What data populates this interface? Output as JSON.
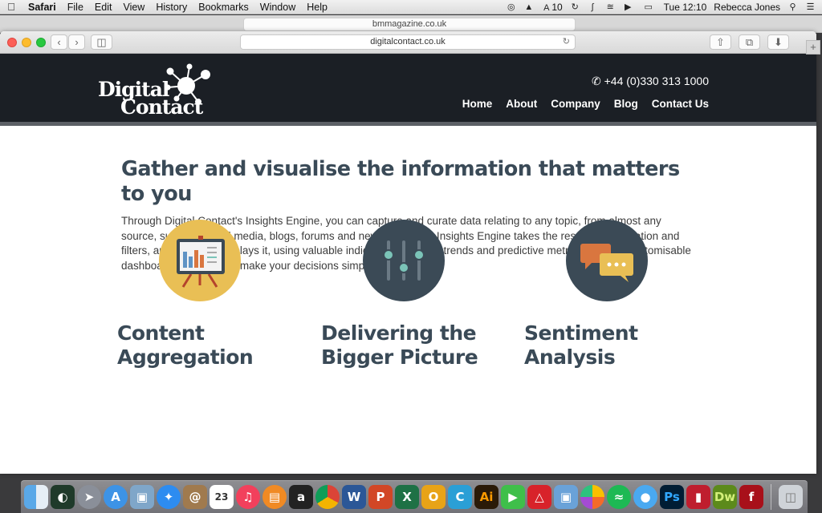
{
  "menubar": {
    "app": "Safari",
    "items": [
      "File",
      "Edit",
      "View",
      "History",
      "Bookmarks",
      "Window",
      "Help"
    ],
    "status_count": "10",
    "clock": "Tue 12:10",
    "user": "Rebecca Jones"
  },
  "back_window": {
    "url": "bmmagazine.co.uk"
  },
  "browser": {
    "url": "digitalcontact.co.uk"
  },
  "site": {
    "logo_line1": "Digital",
    "logo_line2": "Contact",
    "phone": "+44 (0)330 313 1000",
    "nav": [
      "Home",
      "About",
      "Company",
      "Blog",
      "Contact Us"
    ]
  },
  "main": {
    "headline": "Gather and visualise the information that matters to you",
    "intro": "Through Digital Contact's Insights Engine, you can capture and curate data relating to any topic, from almost any source, such as: social media, blogs, forums and news sites. The Insights Engine takes the resulting information and filters, analyses and displays it, using valuable indicators, patterns, trends and predictive metrics, through customisable dashboards – helping to make your decisions simple with big data.",
    "features": [
      {
        "title_line1": "Content",
        "title_line2": "Aggregation",
        "icon": "presentation-board-icon",
        "color": "#e9bf55"
      },
      {
        "title_line1": "Delivering the",
        "title_line2": "Bigger Picture",
        "icon": "sliders-icon",
        "color": "#3b4a56"
      },
      {
        "title_line1": "Sentiment",
        "title_line2": "Analysis",
        "icon": "chat-bubbles-icon",
        "color": "#3b4a56"
      }
    ]
  },
  "dock": {
    "calendar_day": "23",
    "apps": [
      "finder",
      "dashboard",
      "launchpad",
      "app-store",
      "preview",
      "safari",
      "contacts",
      "calendar",
      "itunes",
      "ibooks",
      "text-app",
      "chrome",
      "word",
      "powerpoint",
      "excel",
      "outlook",
      "other-c",
      "illustrator",
      "facetime",
      "acrobat",
      "preview-2",
      "photos",
      "spotify",
      "messages",
      "photoshop",
      "filezilla",
      "dreamweaver",
      "flash",
      "trash"
    ]
  },
  "colors": {
    "header_bg": "#1b1f25",
    "heading_text": "#3a4a57",
    "accent_yellow": "#e9bf55",
    "accent_teal": "#7bc4b8",
    "accent_orange": "#d9763f"
  }
}
